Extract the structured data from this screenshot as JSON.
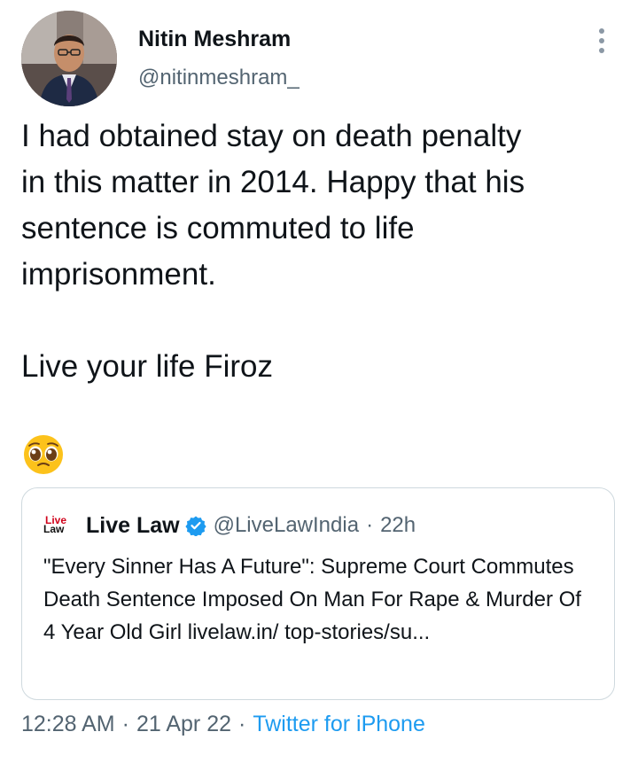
{
  "author": {
    "name": "Nitin Meshram",
    "handle": "@nitinmeshram_"
  },
  "tweet": {
    "text": "I had obtained stay on death penalty\nin this matter in 2014. Happy that his\nsentence is commuted to life\nimprisonment.\n\nLive your life Firoz",
    "emoji": "pleading-face-emoji"
  },
  "quoted_tweet": {
    "logo_top": "Live",
    "logo_bottom": "Law",
    "name": "Live Law",
    "verified_icon": "verified-badge-icon",
    "handle": "@LiveLawIndia",
    "separator": "·",
    "time": "22h",
    "text": "\"Every Sinner Has A Future\": Supreme Court Commutes Death Sentence Imposed On Man For Rape & Murder Of 4 Year Old Girl livelaw.in/ top-stories/su..."
  },
  "footer": {
    "time": "12:28 AM",
    "separator": "·",
    "date": "21 Apr 22",
    "source": "Twitter for iPhone"
  },
  "colors": {
    "text": "#0f1419",
    "secondary": "#536471",
    "link": "#1d9bf0",
    "border": "#cfd9de",
    "livelaw_red": "#d0021b"
  }
}
